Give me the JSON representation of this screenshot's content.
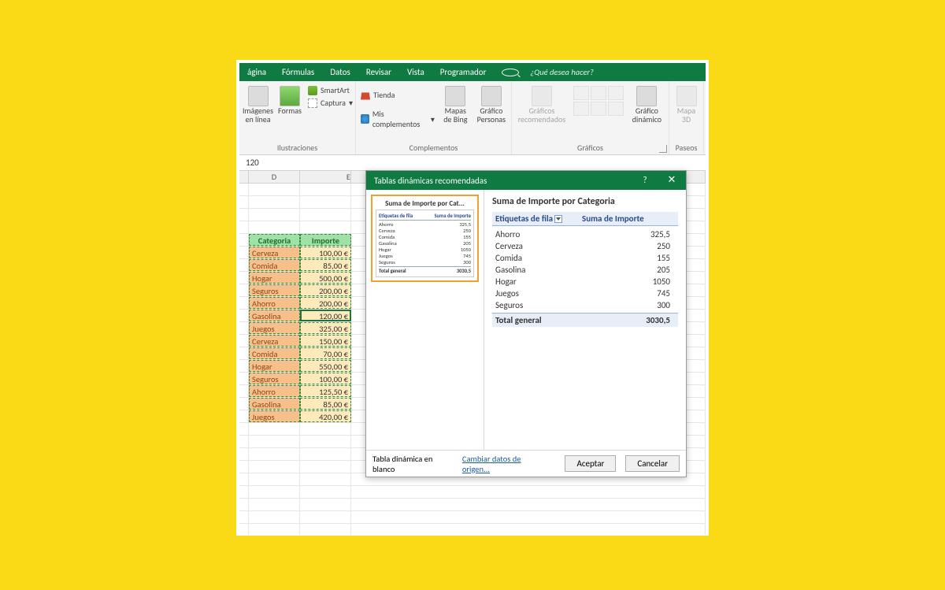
{
  "menu": {
    "items": [
      "ágina",
      "Fórmulas",
      "Datos",
      "Revisar",
      "Vista",
      "Programador"
    ],
    "search_placeholder": "¿Qué desea hacer?"
  },
  "ribbon": {
    "groups": {
      "ilustraciones": {
        "label": "Ilustraciones",
        "imagenes": "Imágenes\nen línea",
        "formas": "Formas",
        "smartart": "SmartArt",
        "captura": "Captura"
      },
      "complementos": {
        "label": "Complementos",
        "tienda": "Tienda",
        "mis": "Mis complementos",
        "bing": "Mapas\nde Bing",
        "personas": "Gráfico\nPersonas"
      },
      "graficos": {
        "label": "Gráficos",
        "recom": "Gráficos\nrecomendados",
        "dinamico": "Gráfico\ndinámico"
      },
      "paseos": {
        "label": "Paseos",
        "mapa": "Mapa\n3D"
      }
    }
  },
  "formula_bar": {
    "value": "120"
  },
  "sheet": {
    "col_headers": [
      "D",
      "E"
    ],
    "table": {
      "headers": {
        "cat": "Categoria",
        "imp": "Importe"
      },
      "rows": [
        {
          "cat": "Cerveza",
          "imp": "100,00 €"
        },
        {
          "cat": "Comida",
          "imp": "85,00 €"
        },
        {
          "cat": "Hogar",
          "imp": "500,00 €"
        },
        {
          "cat": "Seguros",
          "imp": "200,00 €"
        },
        {
          "cat": "Ahorro",
          "imp": "200,00 €"
        },
        {
          "cat": "Gasolina",
          "imp": "120,00 €"
        },
        {
          "cat": "Juegos",
          "imp": "325,00 €"
        },
        {
          "cat": "Cerveza",
          "imp": "150,00 €"
        },
        {
          "cat": "Comida",
          "imp": "70,00 €"
        },
        {
          "cat": "Hogar",
          "imp": "550,00 €"
        },
        {
          "cat": "Seguros",
          "imp": "100,00 €"
        },
        {
          "cat": "Ahorro",
          "imp": "125,50 €"
        },
        {
          "cat": "Gasolina",
          "imp": "85,00 €"
        },
        {
          "cat": "Juegos",
          "imp": "420,00 €"
        }
      ]
    }
  },
  "dialog": {
    "title": "Tablas dinámicas recomendadas",
    "thumb_title": "Suma de Importe por Cat...",
    "thumb_header": {
      "a": "Etiquetas de fila",
      "b": "Suma de Importe"
    },
    "preview_title": "Suma de Importe por Categoria",
    "header": {
      "a": "Etiquetas de fila",
      "b": "Suma de Importe"
    },
    "rows": [
      {
        "cat": "Ahorro",
        "val": "325,5"
      },
      {
        "cat": "Cerveza",
        "val": "250"
      },
      {
        "cat": "Comida",
        "val": "155"
      },
      {
        "cat": "Gasolina",
        "val": "205"
      },
      {
        "cat": "Hogar",
        "val": "1050"
      },
      {
        "cat": "Juegos",
        "val": "745"
      },
      {
        "cat": "Seguros",
        "val": "300"
      }
    ],
    "total_label": "Total general",
    "total_value": "3030,5",
    "footer": {
      "blank": "Tabla dinámica en blanco",
      "change": "Cambiar datos de origen...",
      "ok": "Aceptar",
      "cancel": "Cancelar"
    }
  }
}
